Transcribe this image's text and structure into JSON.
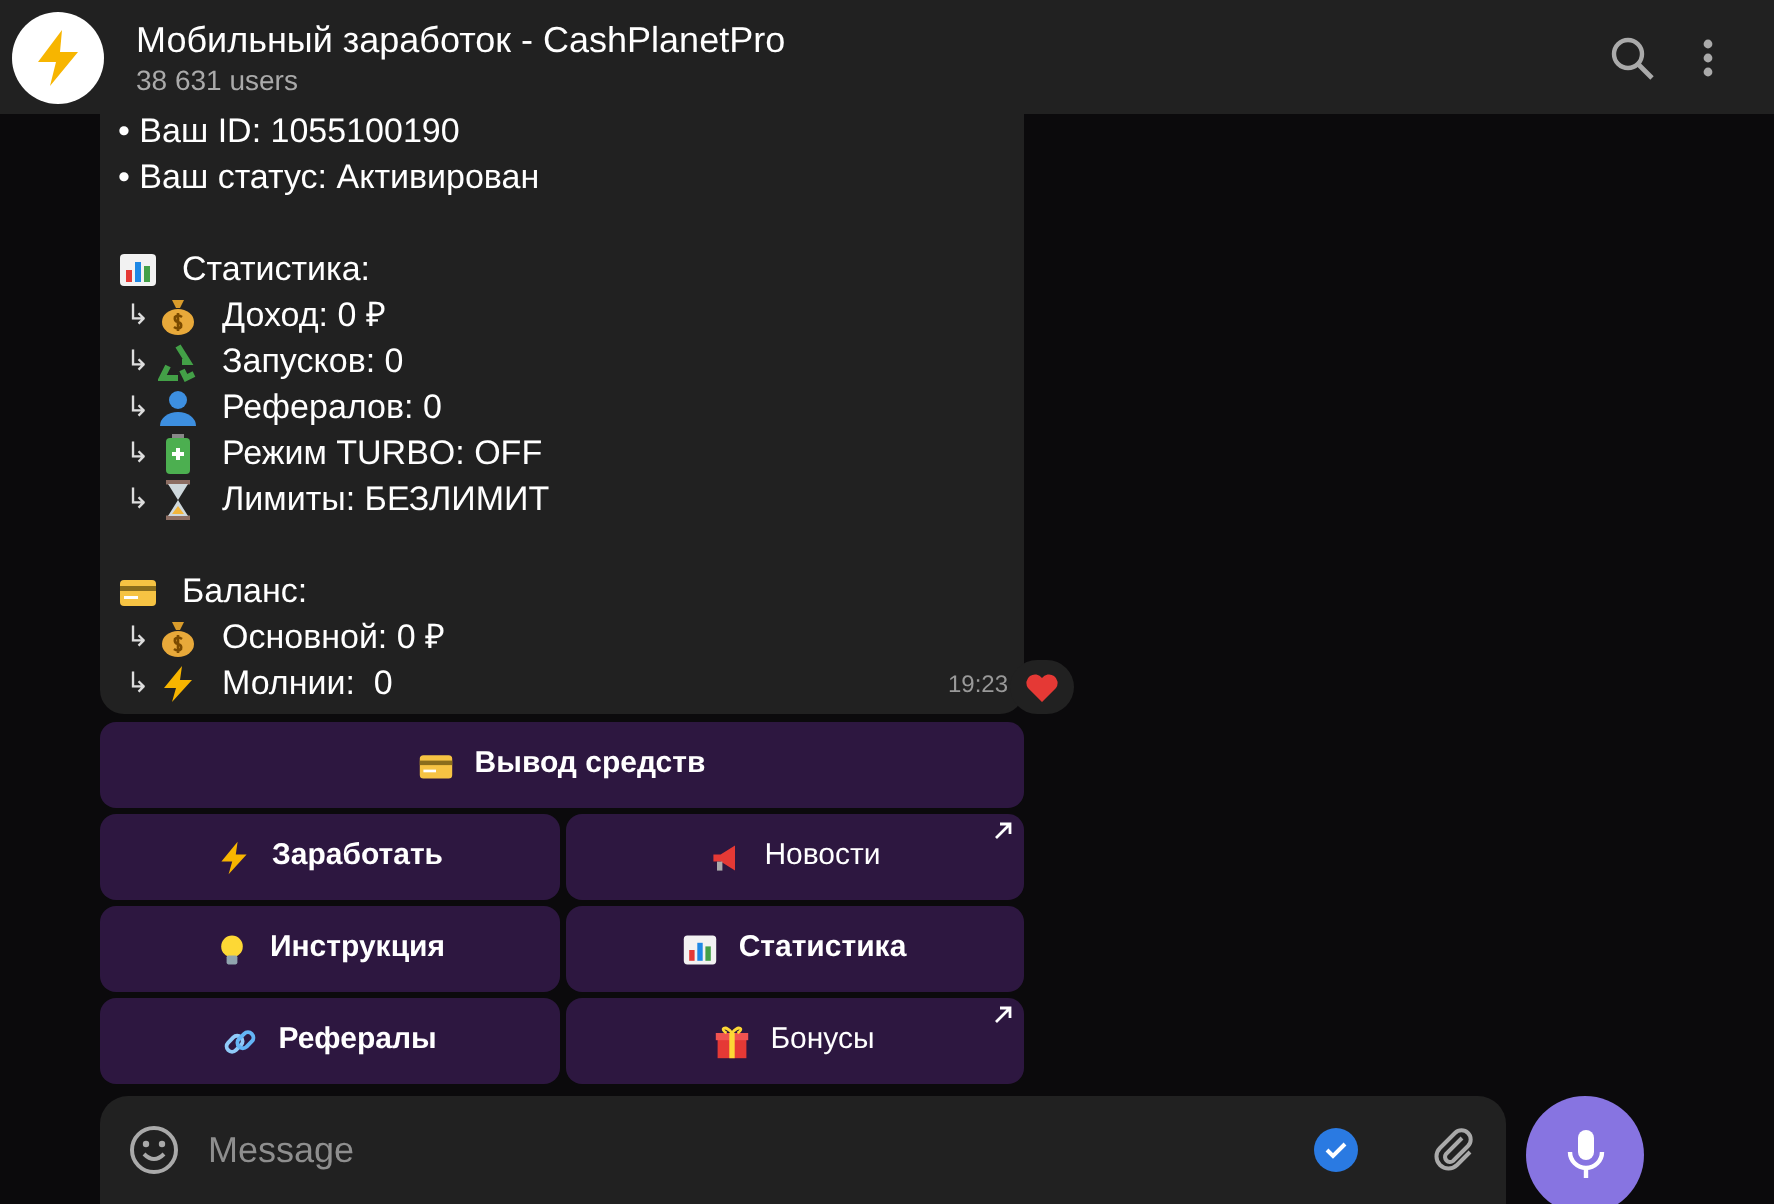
{
  "header": {
    "title": "Мобильный заработок - CashPlanetPro",
    "subtitle": "38 631 users"
  },
  "message": {
    "lines": [
      {
        "kind": "bullet",
        "text": "• Ваш ID: 1055100190"
      },
      {
        "kind": "bullet",
        "text": "• Ваш статус: Активирован"
      },
      {
        "kind": "blank"
      },
      {
        "kind": "heading",
        "text": "Статистика:"
      },
      {
        "kind": "sub",
        "arrow": "↳",
        "text": "Доход: 0 ₽"
      },
      {
        "kind": "sub",
        "arrow": "↳",
        "text": "Запусков: 0"
      },
      {
        "kind": "sub",
        "arrow": "↳",
        "text": "Рефералов: 0"
      },
      {
        "kind": "sub",
        "arrow": "↳",
        "text": "Режим TURBO: OFF"
      },
      {
        "kind": "sub",
        "arrow": "↳",
        "text": "Лимиты: БЕЗЛИМИТ"
      },
      {
        "kind": "blank"
      },
      {
        "kind": "heading",
        "text": "Баланс:"
      },
      {
        "kind": "sub",
        "arrow": "↳",
        "text": "Основной: 0 ₽"
      },
      {
        "kind": "sub",
        "arrow": "↳",
        "text": "Молнии:  0"
      }
    ],
    "time": "19:23"
  },
  "keyboard": [
    [
      {
        "label": "Вывод средств",
        "external": false,
        "bold": true
      }
    ],
    [
      {
        "label": "Заработать",
        "external": false,
        "bold": true
      },
      {
        "label": "Новости",
        "external": true,
        "bold": false
      }
    ],
    [
      {
        "label": "Инструкция",
        "external": false,
        "bold": true
      },
      {
        "label": "Статистика",
        "external": false,
        "bold": true
      }
    ],
    [
      {
        "label": "Рефералы",
        "external": false,
        "bold": true
      },
      {
        "label": "Бонусы",
        "external": true,
        "bold": false
      }
    ]
  ],
  "composer": {
    "placeholder": "Message"
  }
}
